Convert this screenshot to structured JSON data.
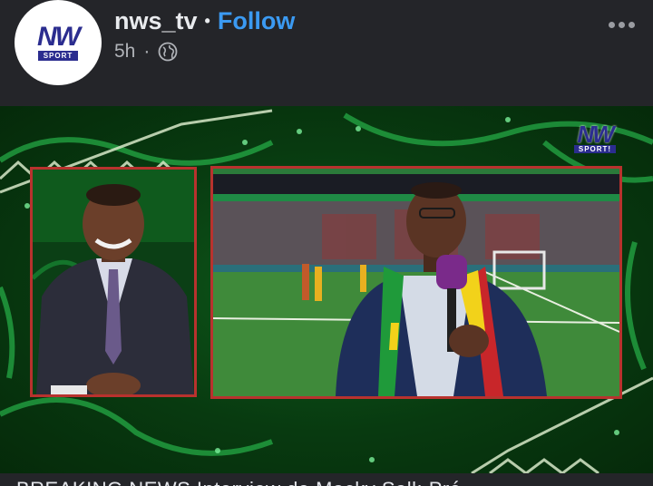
{
  "post": {
    "username": "nws_tv",
    "separator": "•",
    "follow_label": "Follow",
    "time": "5h",
    "meta_separator": "·",
    "privacy_icon": "globe-icon",
    "more_icon": "more-options-icon"
  },
  "avatar": {
    "logo_main": "NW",
    "logo_sub": "SPORT"
  },
  "video": {
    "logo_main": "NW",
    "logo_sub": "SPORT!",
    "accent_border": "#b8322e"
  },
  "caption": {
    "text": "BREAKING NEWS Interview de Macky Sall: Pré"
  }
}
